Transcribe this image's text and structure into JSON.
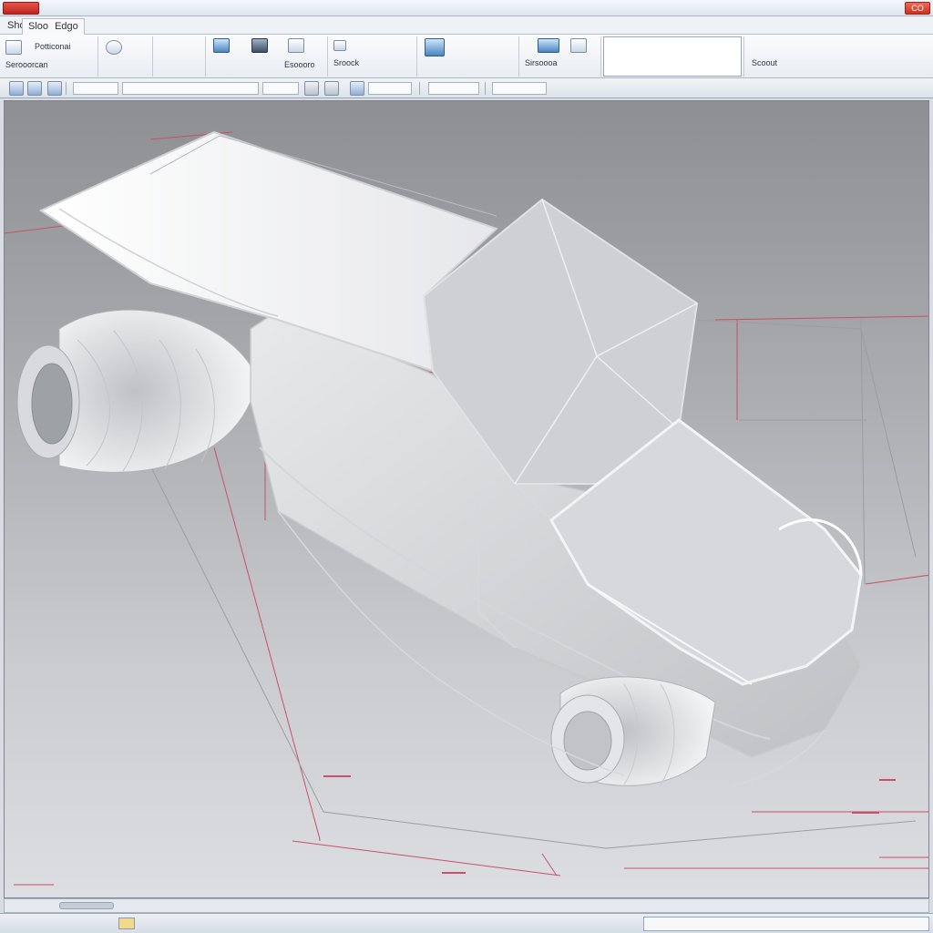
{
  "title_bar": {
    "app_button": "",
    "title": "",
    "right_text": "",
    "help": "",
    "close": "CO"
  },
  "tabs": [
    {
      "label": "Sho"
    },
    {
      "label": "Sloo"
    },
    {
      "label": "Edgo"
    }
  ],
  "ribbon": {
    "group1": {
      "top": "Potticonai",
      "bottom": "Serooorcan"
    },
    "group2": {
      "label": ""
    },
    "group3": {
      "top": "",
      "bottom": ""
    },
    "group4": {
      "labels": [
        "",
        "",
        "Esoooro"
      ]
    },
    "group5": {
      "label": "Sroock"
    },
    "group6": {
      "top": "",
      "bottom": ""
    },
    "group7": {
      "label": "Sirsoooa"
    },
    "property_panel": {
      "line1": "",
      "line2": "",
      "line3": ""
    },
    "group8": {
      "top": "",
      "bottom": "Scoout"
    }
  },
  "toolbar": {
    "field1": "",
    "field2": "",
    "field3": ""
  },
  "hscroll": {
    "left_text": "",
    "right_text": ""
  },
  "status": {
    "left_text": "",
    "badge": "",
    "right_text": ""
  },
  "colors": {
    "accent_red": "#c8321f",
    "construction_line": "#c9506a",
    "viewport_top": "#8d8f93",
    "viewport_bottom": "#dcdee1"
  }
}
